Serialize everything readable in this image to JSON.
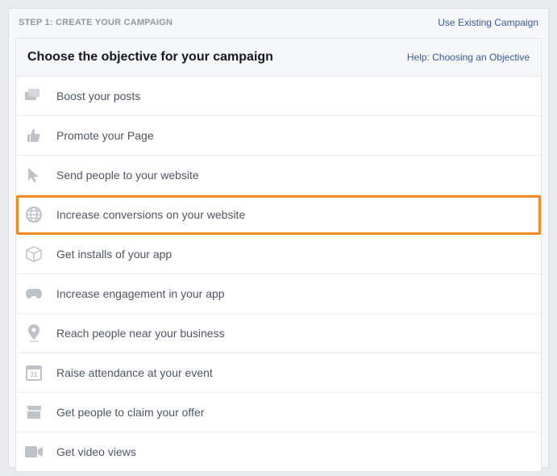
{
  "topBar": {
    "step": "STEP 1: CREATE YOUR CAMPAIGN",
    "useExisting": "Use Existing Campaign"
  },
  "header": {
    "title": "Choose the objective for your campaign",
    "helpLink": "Help: Choosing an Objective"
  },
  "objectives": [
    {
      "label": "Boost your posts",
      "icon": "boost-posts-icon"
    },
    {
      "label": "Promote your Page",
      "icon": "thumbs-up-icon"
    },
    {
      "label": "Send people to your website",
      "icon": "cursor-icon"
    },
    {
      "label": "Increase conversions on your website",
      "icon": "globe-icon",
      "highlighted": true
    },
    {
      "label": "Get installs of your app",
      "icon": "box-icon"
    },
    {
      "label": "Increase engagement in your app",
      "icon": "gamepad-icon"
    },
    {
      "label": "Reach people near your business",
      "icon": "pin-icon"
    },
    {
      "label": "Raise attendance at your event",
      "icon": "calendar-icon"
    },
    {
      "label": "Get people to claim your offer",
      "icon": "storefront-icon"
    },
    {
      "label": "Get video views",
      "icon": "video-icon"
    }
  ]
}
